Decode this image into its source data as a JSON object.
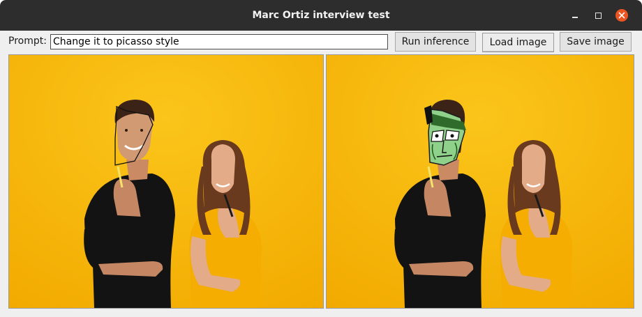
{
  "window": {
    "title": "Marc Ortiz interview test"
  },
  "toolbar": {
    "prompt_label": "Prompt:",
    "prompt_value": "Change it to picasso style",
    "run_label": "Run inference",
    "load_label": "Load image",
    "save_label": "Save image"
  },
  "panels": {
    "input_image": "input-photo",
    "output_image": "output-photo"
  },
  "colors": {
    "titlebar": "#2d2d2d",
    "close_button": "#e95420",
    "photo_background": "#f7b707"
  }
}
